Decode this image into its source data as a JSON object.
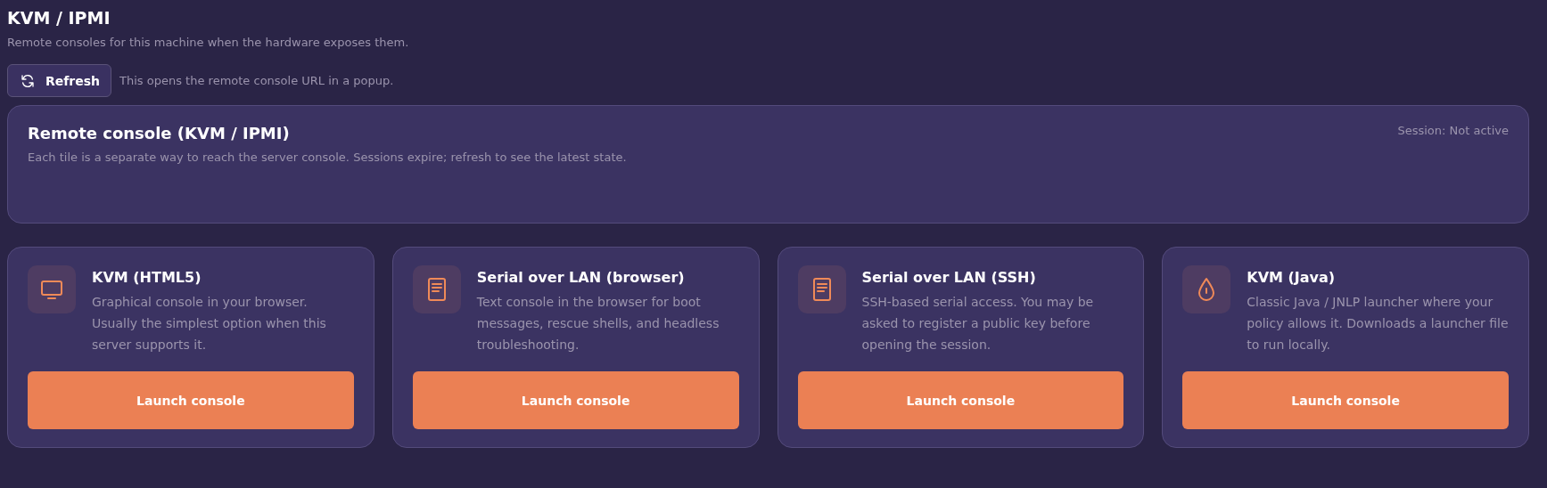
{
  "page": {
    "title": "KVM / IPMI",
    "subtitle": "Remote consoles for this machine when the hardware exposes them."
  },
  "toolbar": {
    "button": "Refresh",
    "hint": "This opens the remote console URL in a popup."
  },
  "summary": {
    "title": "Remote console (KVM / IPMI)",
    "description": "Each tile is a separate way to reach the server console. Sessions expire; refresh to see the latest state.",
    "session": "Session: Not active"
  },
  "tiles": [
    {
      "title": "KVM (HTML5)",
      "description": "Graphical console in your browser. Usually the simplest option when this server supports it.",
      "button": "Launch console"
    },
    {
      "title": "Serial over LAN (browser)",
      "description": "Text console in the browser for boot messages, rescue shells, and headless troubleshooting.",
      "button": "Launch console"
    },
    {
      "title": "Serial over LAN (SSH)",
      "description": "SSH-based serial access. You may be asked to register a public key before opening the session.",
      "button": "Launch console"
    },
    {
      "title": "KVM (Java)",
      "description": "Classic Java / JNLP launcher where your policy allows it. Downloads a launcher file to run locally.",
      "button": "Launch console"
    }
  ]
}
